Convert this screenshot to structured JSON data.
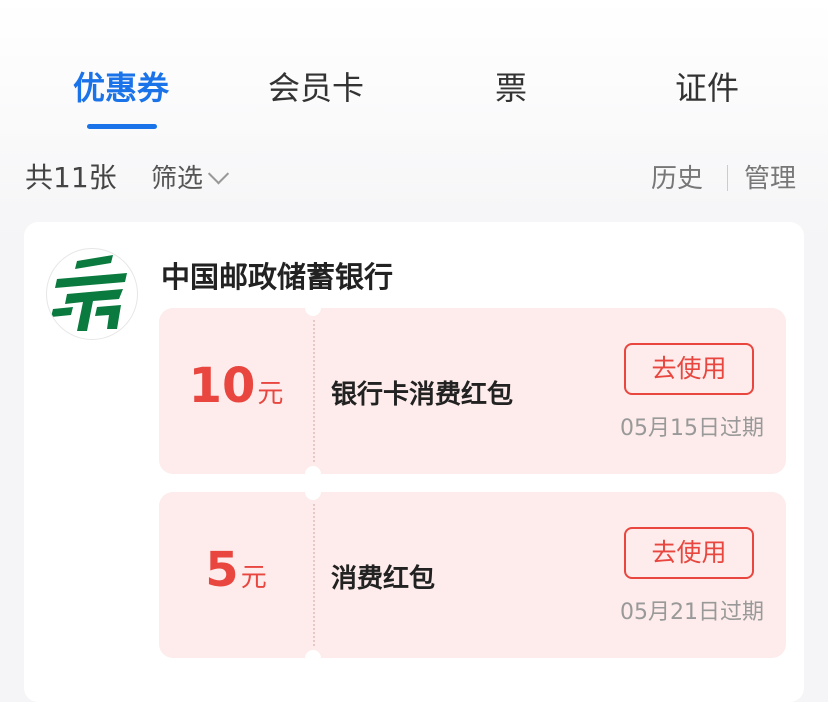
{
  "tabs": [
    {
      "label": "优惠券",
      "active": true
    },
    {
      "label": "会员卡",
      "active": false
    },
    {
      "label": "票",
      "active": false
    },
    {
      "label": "证件",
      "active": false
    }
  ],
  "filter": {
    "count_label": "共11张",
    "filter_label": "筛选",
    "history_label": "历史",
    "manage_label": "管理"
  },
  "card": {
    "bank_name": "中国邮政储蓄银行",
    "logo_icon": "china-post-logo-icon",
    "coupons": [
      {
        "amount": "10",
        "unit": "元",
        "title": "银行卡消费红包",
        "action": "去使用",
        "expiry": "05月15日过期"
      },
      {
        "amount": "5",
        "unit": "元",
        "title": "消费红包",
        "action": "去使用",
        "expiry": "05月21日过期"
      }
    ]
  },
  "colors": {
    "accent": "#1a73e8",
    "coupon_red": "#e8463f",
    "coupon_bg": "#fdeceb",
    "logo_green": "#0b7a3e"
  }
}
